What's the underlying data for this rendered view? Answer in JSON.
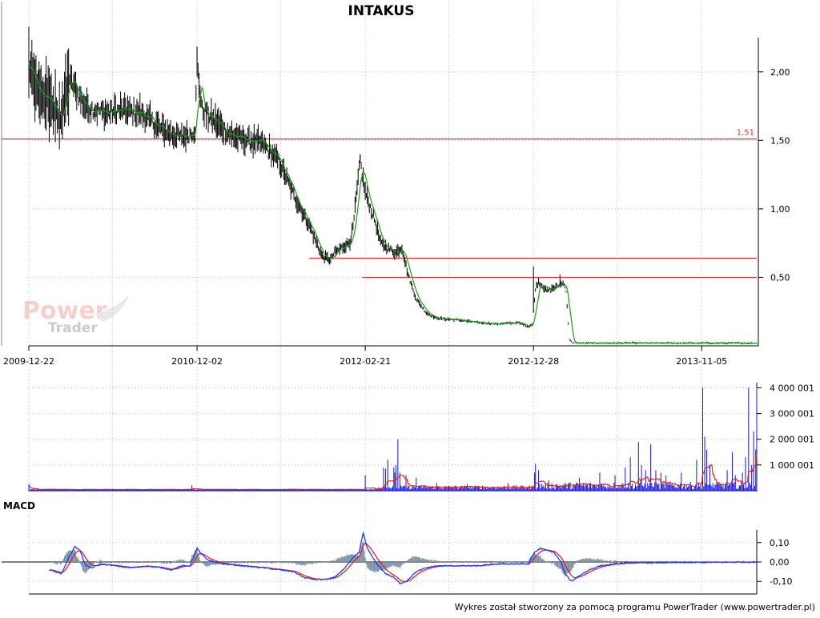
{
  "title": "INTAKUS",
  "footer": "Wykres został stworzony za pomocą programu PowerTrader (www.powertrader.pl)",
  "watermark": {
    "line1": "Power",
    "line2": "Trader"
  },
  "colors": {
    "price_bar": "#000000",
    "moving_average": "#16a016",
    "level_line": "#e03030",
    "volume_bar": "#1414e6",
    "volume_average": "#e62020",
    "macd_line": "#1a3cff",
    "signal_line": "#e62020",
    "histogram": "#7890a0",
    "grid": "#b8b8b8"
  },
  "chart_data": [
    {
      "type": "line",
      "name": "price",
      "ylim": [
        0.0,
        2.25
      ],
      "yticks": [
        {
          "value": 2.0,
          "label": "2,00"
        },
        {
          "value": 1.5,
          "label": "1,50"
        },
        {
          "value": 1.0,
          "label": "1,00"
        },
        {
          "value": 0.5,
          "label": "0,50"
        }
      ],
      "xticks": [
        {
          "i": 0,
          "label": "2009-12-22"
        },
        {
          "i": 165,
          "label": "2010-12-02"
        },
        {
          "i": 330,
          "label": "2012-02-21"
        },
        {
          "i": 495,
          "label": "2012-12-28"
        },
        {
          "i": 660,
          "label": "2013-11-05"
        }
      ],
      "n_sessions": 715,
      "price_keypoints": [
        [
          0,
          2.05
        ],
        [
          8,
          1.85
        ],
        [
          20,
          1.8
        ],
        [
          30,
          1.65
        ],
        [
          40,
          1.95
        ],
        [
          55,
          1.75
        ],
        [
          75,
          1.7
        ],
        [
          90,
          1.72
        ],
        [
          110,
          1.7
        ],
        [
          130,
          1.58
        ],
        [
          150,
          1.52
        ],
        [
          160,
          1.56
        ],
        [
          163,
          1.58
        ],
        [
          165,
          2.05
        ],
        [
          170,
          1.72
        ],
        [
          185,
          1.62
        ],
        [
          200,
          1.53
        ],
        [
          215,
          1.5
        ],
        [
          230,
          1.47
        ],
        [
          245,
          1.35
        ],
        [
          260,
          1.1
        ],
        [
          275,
          0.88
        ],
        [
          288,
          0.65
        ],
        [
          296,
          0.63
        ],
        [
          300,
          0.68
        ],
        [
          315,
          0.76
        ],
        [
          318,
          0.86
        ],
        [
          325,
          1.35
        ],
        [
          330,
          1.12
        ],
        [
          340,
          0.9
        ],
        [
          345,
          0.75
        ],
        [
          355,
          0.7
        ],
        [
          360,
          0.68
        ],
        [
          366,
          0.72
        ],
        [
          372,
          0.52
        ],
        [
          380,
          0.34
        ],
        [
          390,
          0.24
        ],
        [
          400,
          0.2
        ],
        [
          420,
          0.19
        ],
        [
          440,
          0.17
        ],
        [
          460,
          0.16
        ],
        [
          480,
          0.17
        ],
        [
          490,
          0.14
        ],
        [
          494,
          0.16
        ],
        [
          497,
          0.42
        ],
        [
          500,
          0.47
        ],
        [
          508,
          0.4
        ],
        [
          520,
          0.44
        ],
        [
          525,
          0.46
        ],
        [
          527,
          0.4
        ],
        [
          530,
          0.05
        ],
        [
          533,
          0.02
        ],
        [
          715,
          0.02
        ]
      ],
      "levels": [
        {
          "value": 1.51,
          "from_i": -30,
          "label": "1,51"
        },
        {
          "value": 0.64,
          "from_i": 275,
          "label": ""
        },
        {
          "value": 0.5,
          "from_i": 327,
          "label": ""
        }
      ]
    },
    {
      "type": "bar",
      "name": "volume",
      "ylim": [
        0,
        4200000
      ],
      "yticks": [
        {
          "value": 4000001,
          "label": "4 000 001"
        },
        {
          "value": 3000001,
          "label": "3 000 001"
        },
        {
          "value": 2000001,
          "label": "2 000 001"
        },
        {
          "value": 1000001,
          "label": "1 000 001"
        }
      ],
      "spikes": [
        [
          0,
          250000
        ],
        [
          160,
          220000
        ],
        [
          330,
          600000
        ],
        [
          348,
          900000
        ],
        [
          350,
          850000
        ],
        [
          352,
          1200000
        ],
        [
          358,
          900000
        ],
        [
          359,
          700000
        ],
        [
          360,
          1000000
        ],
        [
          362,
          2000000
        ],
        [
          364,
          700000
        ],
        [
          370,
          600000
        ],
        [
          380,
          500000
        ],
        [
          400,
          300000
        ],
        [
          430,
          250000
        ],
        [
          470,
          300000
        ],
        [
          494,
          200000
        ],
        [
          496,
          700000
        ],
        [
          497,
          1050000
        ],
        [
          500,
          800000
        ],
        [
          510,
          400000
        ],
        [
          540,
          500000
        ],
        [
          560,
          700000
        ],
        [
          575,
          600000
        ],
        [
          585,
          900000
        ],
        [
          590,
          1300000
        ],
        [
          598,
          1900000
        ],
        [
          601,
          1000000
        ],
        [
          605,
          800000
        ],
        [
          610,
          1800000
        ],
        [
          615,
          800000
        ],
        [
          620,
          700000
        ],
        [
          625,
          600000
        ],
        [
          640,
          700000
        ],
        [
          655,
          1200000
        ],
        [
          661,
          4000001
        ],
        [
          663,
          2100000
        ],
        [
          665,
          1600000
        ],
        [
          668,
          1000000
        ],
        [
          685,
          800000
        ],
        [
          690,
          1500000
        ],
        [
          693,
          600000
        ],
        [
          700,
          700000
        ],
        [
          703,
          1300000
        ],
        [
          706,
          4000001
        ],
        [
          709,
          1000000
        ],
        [
          711,
          2300000
        ],
        [
          713,
          1600000
        ],
        [
          714,
          4000001
        ]
      ]
    },
    {
      "type": "line",
      "name": "MACD",
      "ylim": [
        -0.165,
        0.165
      ],
      "yticks": [
        {
          "value": 0.1,
          "label": "0,10"
        },
        {
          "value": 0.0,
          "label": "0,00"
        },
        {
          "value": -0.1,
          "label": "-0,10"
        }
      ],
      "macd_keypoints": [
        [
          20,
          -0.04
        ],
        [
          32,
          -0.06
        ],
        [
          40,
          0.03
        ],
        [
          45,
          0.08
        ],
        [
          50,
          0.06
        ],
        [
          56,
          -0.02
        ],
        [
          62,
          -0.03
        ],
        [
          70,
          -0.01
        ],
        [
          85,
          -0.02
        ],
        [
          100,
          -0.03
        ],
        [
          115,
          -0.02
        ],
        [
          130,
          -0.03
        ],
        [
          140,
          -0.04
        ],
        [
          150,
          -0.02
        ],
        [
          158,
          -0.02
        ],
        [
          165,
          0.07
        ],
        [
          168,
          0.05
        ],
        [
          175,
          0.01
        ],
        [
          190,
          -0.01
        ],
        [
          210,
          -0.02
        ],
        [
          230,
          -0.03
        ],
        [
          245,
          -0.04
        ],
        [
          260,
          -0.05
        ],
        [
          270,
          -0.08
        ],
        [
          280,
          -0.09
        ],
        [
          290,
          -0.09
        ],
        [
          300,
          -0.08
        ],
        [
          310,
          -0.03
        ],
        [
          318,
          0.02
        ],
        [
          324,
          0.05
        ],
        [
          328,
          0.15
        ],
        [
          332,
          0.07
        ],
        [
          340,
          0.0
        ],
        [
          350,
          -0.06
        ],
        [
          358,
          -0.08
        ],
        [
          364,
          -0.11
        ],
        [
          370,
          -0.1
        ],
        [
          380,
          -0.05
        ],
        [
          390,
          -0.03
        ],
        [
          400,
          -0.02
        ],
        [
          420,
          -0.02
        ],
        [
          440,
          -0.02
        ],
        [
          460,
          -0.01
        ],
        [
          480,
          -0.01
        ],
        [
          490,
          -0.01
        ],
        [
          496,
          0.05
        ],
        [
          502,
          0.07
        ],
        [
          508,
          0.06
        ],
        [
          515,
          0.05
        ],
        [
          522,
          0.0
        ],
        [
          526,
          -0.06
        ],
        [
          532,
          -0.1
        ],
        [
          540,
          -0.07
        ],
        [
          550,
          -0.04
        ],
        [
          560,
          -0.02
        ],
        [
          575,
          -0.01
        ],
        [
          590,
          -0.005
        ],
        [
          715,
          0.0
        ]
      ]
    }
  ]
}
